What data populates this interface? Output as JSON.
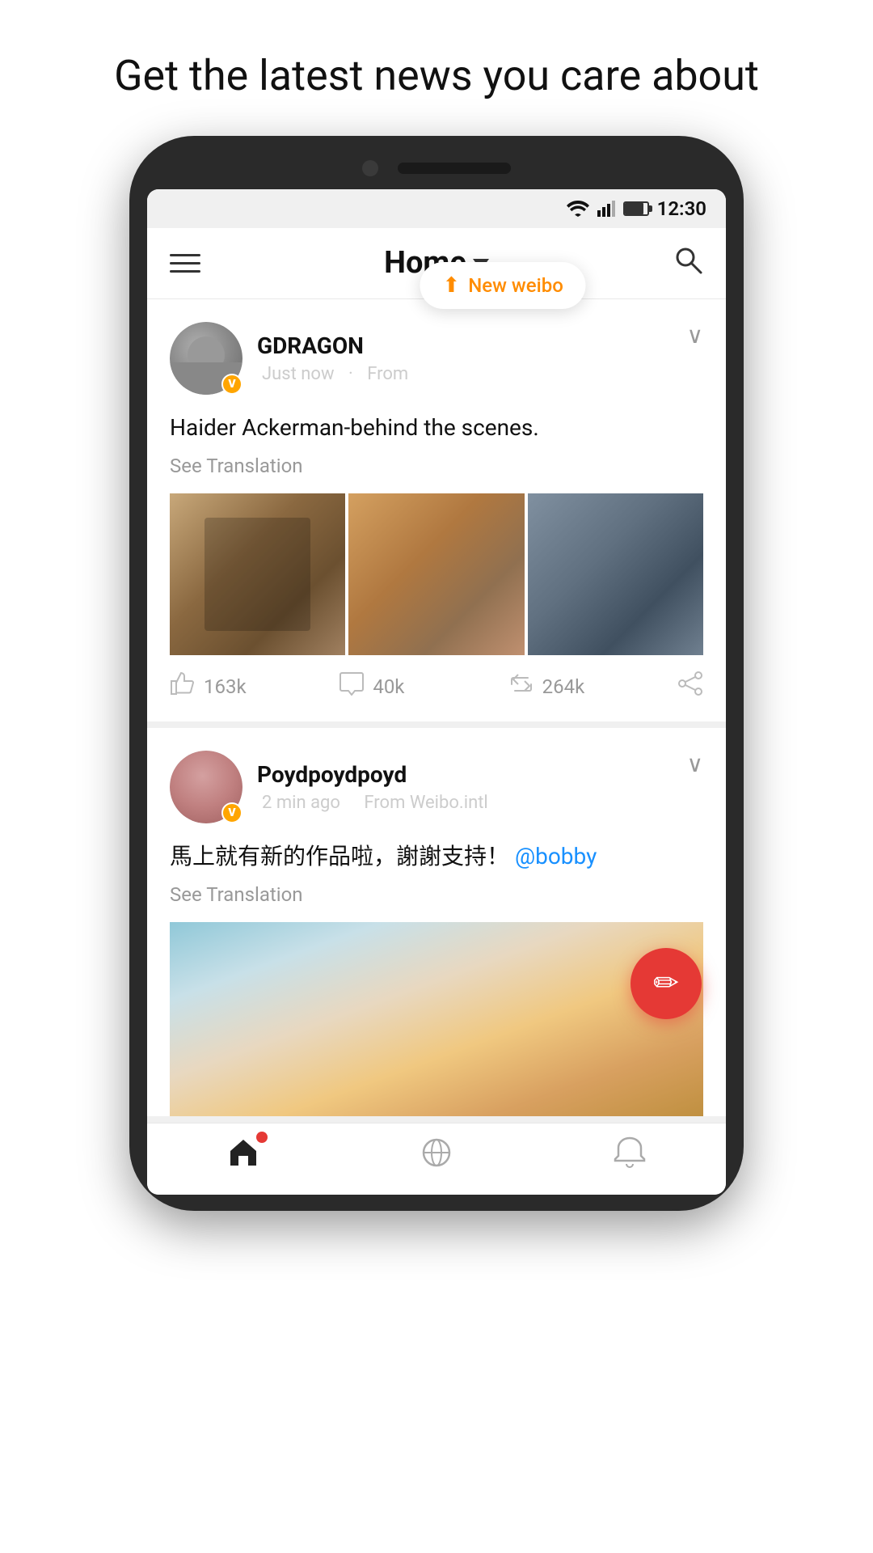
{
  "page": {
    "headline": "Get the latest news you care about"
  },
  "statusBar": {
    "time": "12:30"
  },
  "header": {
    "title": "Home",
    "hamburger_label": "Menu",
    "search_label": "Search"
  },
  "newWeibo": {
    "label": "New weibo"
  },
  "posts": [
    {
      "id": "post1",
      "username": "GDRAGON",
      "time": "Just now",
      "source": "From",
      "content": "Haider Ackerman-behind the scenes.",
      "see_translation": "See Translation",
      "likes": "163k",
      "comments": "40k",
      "reposts": "264k"
    },
    {
      "id": "post2",
      "username": "Poydpoydpoyd",
      "time": "2 min ago",
      "source": "From Weibo.intl",
      "content": "馬上就有新的作品啦，謝謝支持！",
      "mention": "@bobby",
      "see_translation": "See Translation"
    }
  ],
  "bottomNav": {
    "home_label": "Home",
    "discover_label": "Discover",
    "notifications_label": "Notifications"
  }
}
